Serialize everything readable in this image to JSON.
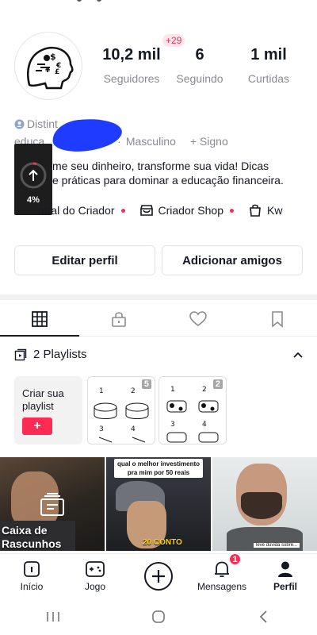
{
  "profile": {
    "stats": [
      {
        "value": "10,2 mil",
        "label": "Seguidores"
      },
      {
        "value": "6",
        "label": "Seguindo"
      },
      {
        "value": "1 mil",
        "label": "Curtidas"
      }
    ],
    "following_badge": "+29",
    "tag_prefix": "Distint",
    "meta_prefix": "educa",
    "meta_gender": "Masculino",
    "meta_sign": "+ Signo",
    "bio_line1": "me seu dinheiro, transforme sua vida! Dicas",
    "bio_line2": "e práticas para dominar a educação financeira.",
    "overlay_percent": "4%"
  },
  "links": [
    {
      "label": "ntral do Criador",
      "icon": "creator-icon",
      "dot": true
    },
    {
      "label": "Criador Shop",
      "icon": "shop-icon",
      "dot": true
    },
    {
      "label": "Kw",
      "icon": "bag-icon",
      "dot": false
    }
  ],
  "buttons": {
    "edit": "Editar perfil",
    "add_friends": "Adicionar amigos"
  },
  "tabs": [
    "grid-icon",
    "lock-icon",
    "heart-icon",
    "bookmark-icon"
  ],
  "playlists": {
    "header": "2 Playlists",
    "create_label": "Criar sua playlist",
    "create_plus": "+",
    "items": [
      {
        "count": "5"
      },
      {
        "count": "2"
      }
    ]
  },
  "videos": [
    {
      "caption": "Caixa de Rascunhos"
    },
    {
      "caption_top": "qual o melhor investimento pra mim por 50 reais",
      "caption_bottom": "20 CONTO"
    },
    {
      "caption_top": "leve duvida sobre..."
    }
  ],
  "nav": [
    {
      "label": "Início",
      "icon": "home-icon"
    },
    {
      "label": "Jogo",
      "icon": "gamepad-icon"
    },
    {
      "label": "",
      "icon": "create-plus-icon"
    },
    {
      "label": "Mensagens",
      "icon": "bell-icon",
      "badge": "1"
    },
    {
      "label": "Perfil",
      "icon": "profile-icon"
    }
  ],
  "colors": {
    "accent": "#fe2c55",
    "text": "#161823",
    "muted": "#8a8b91"
  }
}
